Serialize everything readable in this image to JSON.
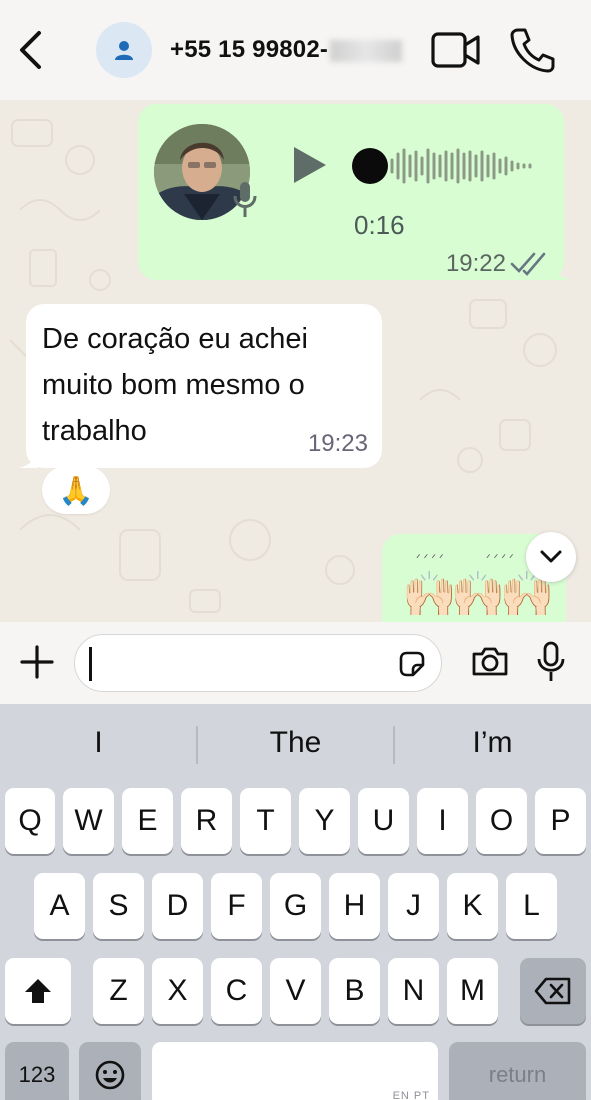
{
  "header": {
    "phone_visible": "+55 15 99802-",
    "back_icon": "chevron-left-icon",
    "video_icon": "video-camera-icon",
    "call_icon": "phone-icon",
    "contact_icon": "person-icon"
  },
  "messages": {
    "voice": {
      "duration": "0:16",
      "time": "19:22",
      "status": "read"
    },
    "incoming_text": {
      "lines": [
        "De coração eu achei",
        "muito bom mesmo o",
        "trabalho"
      ],
      "time": "19:23",
      "reaction": "🙏"
    },
    "outgoing_emoji": {
      "emoji": "🙌🏻🙌🏻🙌🏻🙌🏻"
    }
  },
  "composer": {
    "input_value": "",
    "plus_icon": "plus-icon",
    "sticker_icon": "sticker-icon",
    "camera_icon": "camera-icon",
    "mic_icon": "microphone-icon"
  },
  "keyboard": {
    "suggestions": [
      "I",
      "The",
      "I’m"
    ],
    "row1": [
      "Q",
      "W",
      "E",
      "R",
      "T",
      "Y",
      "U",
      "I",
      "O",
      "P"
    ],
    "row2": [
      "A",
      "S",
      "D",
      "F",
      "G",
      "H",
      "J",
      "K",
      "L"
    ],
    "row3": [
      "Z",
      "X",
      "C",
      "V",
      "B",
      "N",
      "M"
    ],
    "numbers_key": "123",
    "space_hint": "EN PT",
    "return_key": "return"
  },
  "colors": {
    "outgoing_bubble": "#d9fdd3",
    "incoming_bubble": "#ffffff",
    "chat_background": "#efeae2",
    "keyboard_background": "#d2d5db"
  }
}
